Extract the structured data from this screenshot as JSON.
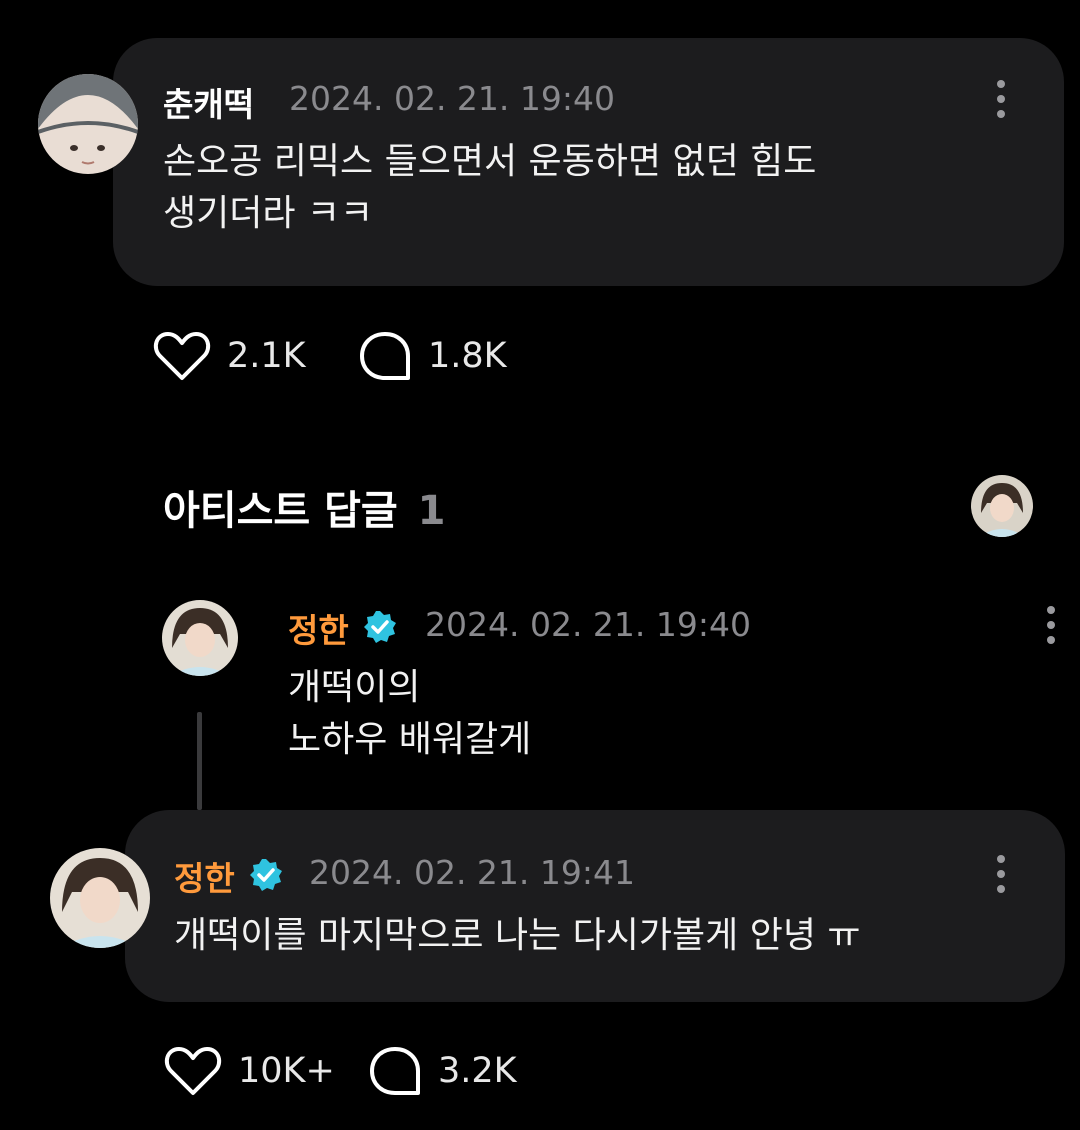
{
  "colors": {
    "background": "#000000",
    "bubble": "#1c1c1e",
    "artist_name": "#ff9a3c",
    "verified": "#2fc3e0",
    "timestamp": "#8a8a8e"
  },
  "comment": {
    "author": "춘캐떡",
    "timestamp": "2024. 02. 21. 19:40",
    "text": "손오공 리믹스 들으면서 운동하면 없던 힘도\n생기더라 ㅋㅋ",
    "likes": "2.1K",
    "replies": "1.8K",
    "icons": {
      "like": "heart-icon",
      "reply": "speech-bubble-icon",
      "more": "more-vertical-icon"
    }
  },
  "artist_section": {
    "title": "아티스트 답글",
    "count": "1"
  },
  "reply": {
    "author": "정한",
    "timestamp": "2024. 02. 21. 19:40",
    "text": "개떡이의\n노하우 배워갈게",
    "icons": {
      "verified": "verified-badge-icon",
      "more": "more-vertical-icon"
    }
  },
  "artist_comment": {
    "author": "정한",
    "timestamp": "2024. 02. 21. 19:41",
    "text": "개떡이를 마지막으로 나는 다시가볼게 안녕 ㅠ",
    "likes": "10K+",
    "replies": "3.2K",
    "icons": {
      "verified": "verified-badge-icon",
      "like": "heart-icon",
      "reply": "speech-bubble-icon",
      "more": "more-vertical-icon"
    }
  }
}
